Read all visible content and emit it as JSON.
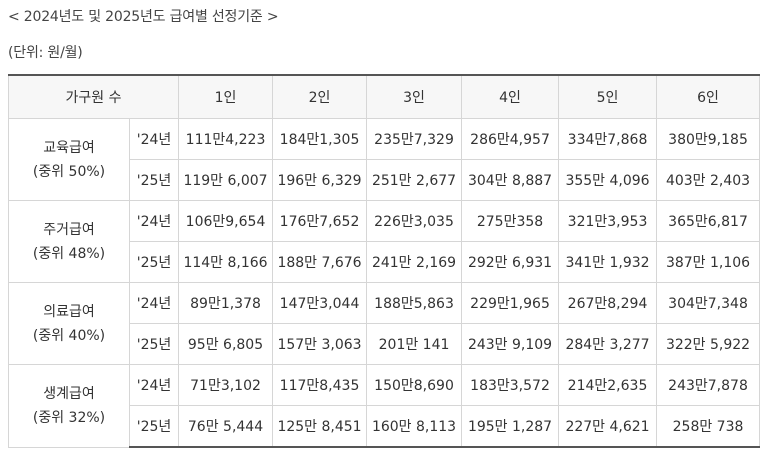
{
  "title": "< 2024년도 및 2025년도 급여별 선정기준 >",
  "unit": "(단위: 원/월)",
  "table": {
    "header_first": "가구원 수",
    "columns": [
      "1인",
      "2인",
      "3인",
      "4인",
      "5인",
      "6인"
    ],
    "groups": [
      {
        "name": "교육급여",
        "ratio": "(중위 50%)",
        "rows": [
          {
            "year": "'24년",
            "values": [
              "111만4,223",
              "184만1,305",
              "235만7,329",
              "286만4,957",
              "334만7,868",
              "380만9,185"
            ]
          },
          {
            "year": "'25년",
            "values": [
              "119만 6,007",
              "196만 6,329",
              "251만 2,677",
              "304만 8,887",
              "355만 4,096",
              "403만 2,403"
            ]
          }
        ]
      },
      {
        "name": "주거급여",
        "ratio": "(중위 48%)",
        "rows": [
          {
            "year": "'24년",
            "values": [
              "106만9,654",
              "176만7,652",
              "226만3,035",
              "275만358",
              "321만3,953",
              "365만6,817"
            ]
          },
          {
            "year": "'25년",
            "values": [
              "114만 8,166",
              "188만 7,676",
              "241만 2,169",
              "292만 6,931",
              "341만 1,932",
              "387만 1,106"
            ]
          }
        ]
      },
      {
        "name": "의료급여",
        "ratio": "(중위 40%)",
        "rows": [
          {
            "year": "'24년",
            "values": [
              "89만1,378",
              "147만3,044",
              "188만5,863",
              "229만1,965",
              "267만8,294",
              "304만7,348"
            ]
          },
          {
            "year": "'25년",
            "values": [
              "95만 6,805",
              "157만 3,063",
              "201만 141",
              "243만 9,109",
              "284만 3,277",
              "322만 5,922"
            ]
          }
        ]
      },
      {
        "name": "생계급여",
        "ratio": "(중위 32%)",
        "rows": [
          {
            "year": "'24년",
            "values": [
              "71만3,102",
              "117만8,435",
              "150만8,690",
              "183만3,572",
              "214만2,635",
              "243만7,878"
            ]
          },
          {
            "year": "'25년",
            "values": [
              "76만 5,444",
              "125만 8,451",
              "160만 8,113",
              "195만 1,287",
              "227만 4,621",
              "258만 738"
            ]
          }
        ]
      }
    ]
  }
}
